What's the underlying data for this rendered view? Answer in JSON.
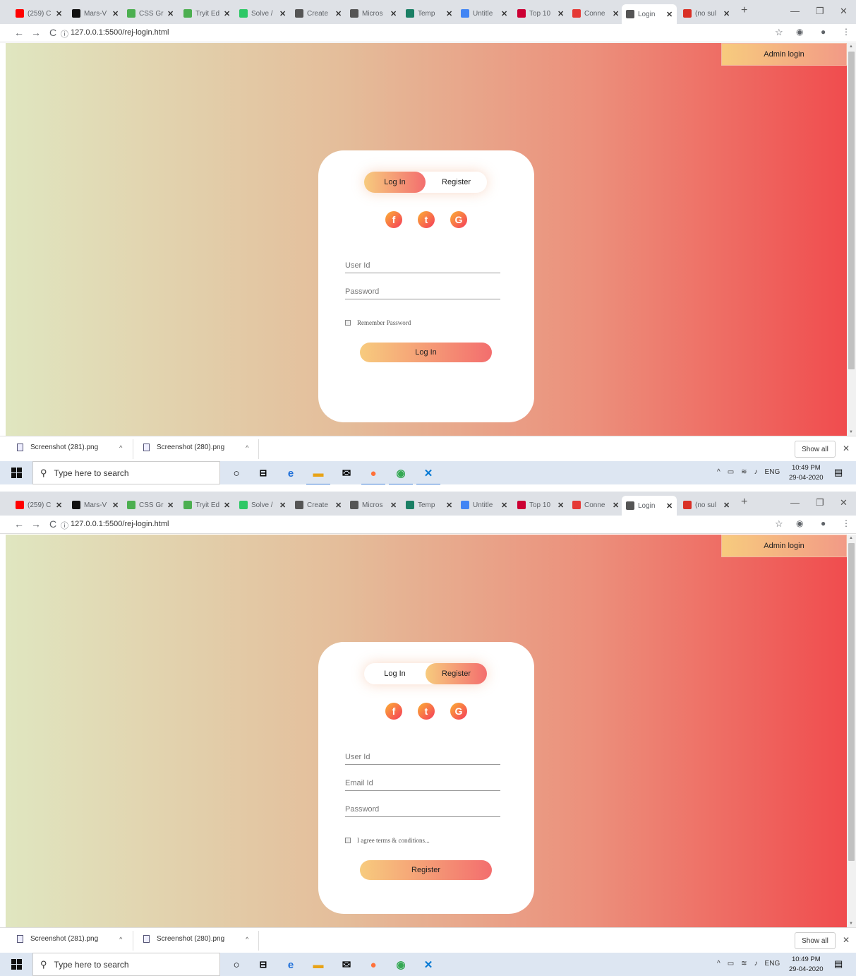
{
  "browser": {
    "tabs": [
      {
        "label": "(259) C",
        "icon": "youtube-icon",
        "color": "#ff0000"
      },
      {
        "label": "Mars-V",
        "icon": "github-icon",
        "color": "#111111"
      },
      {
        "label": "CSS Gr",
        "icon": "w3schools-icon",
        "color": "#4caf50"
      },
      {
        "label": "Tryit Ed",
        "icon": "w3schools-icon",
        "color": "#4caf50"
      },
      {
        "label": "Solve /",
        "icon": "hackerrank-icon",
        "color": "#2ec866"
      },
      {
        "label": "Create",
        "icon": "globe-icon",
        "color": "#555555"
      },
      {
        "label": "Micros",
        "icon": "globe-icon",
        "color": "#555555"
      },
      {
        "label": "Temp",
        "icon": "codepen-icon",
        "color": "#1a7f64"
      },
      {
        "label": "Untitle",
        "icon": "docs-icon",
        "color": "#4285f4"
      },
      {
        "label": "Top 10",
        "icon": "e-icon",
        "color": "#cc0033"
      },
      {
        "label": "Conne",
        "icon": "v-icon",
        "color": "#e53935"
      },
      {
        "label": "Login",
        "icon": "globe-icon",
        "color": "#555555"
      },
      {
        "label": "(no sul",
        "icon": "gmail-icon",
        "color": "#d93025"
      }
    ],
    "new_tab": "+",
    "url": "127.0.0.1:5500/rej-login.html"
  },
  "page": {
    "admin_login": "Admin login",
    "social": {
      "facebook": "f",
      "twitter": "t",
      "google": "G"
    },
    "login_view": {
      "tab_login": "Log In",
      "tab_register": "Register",
      "active_tab": "Log In",
      "user_id_placeholder": "User Id",
      "password_placeholder": "Password",
      "checkbox_label": "Remember Password",
      "submit_label": "Log In"
    },
    "register_view": {
      "tab_login": "Log In",
      "tab_register": "Register",
      "active_tab": "Register",
      "user_id_placeholder": "User Id",
      "email_placeholder": "Email Id",
      "password_placeholder": "Password",
      "checkbox_label": "I agree terms & conditions...",
      "submit_label": "Register"
    },
    "gradient_colors": [
      "#e0e6c0",
      "#f04c4e"
    ],
    "accent_colors": [
      "#f7cb7e",
      "#f36e6e"
    ]
  },
  "downloads": {
    "items": [
      "Screenshot (281).png",
      "Screenshot (280).png"
    ],
    "show_all": "Show all"
  },
  "taskbar": {
    "search_placeholder": "Type here to search",
    "language": "ENG",
    "time": "10:49 PM",
    "date": "29-04-2020"
  }
}
